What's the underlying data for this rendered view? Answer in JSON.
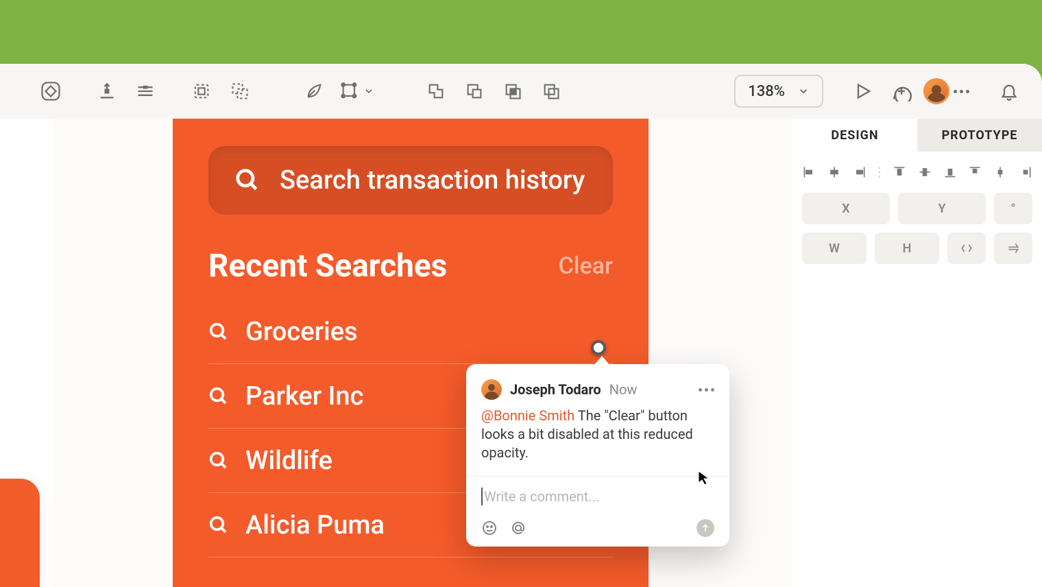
{
  "toolbar": {
    "zoom": "138%"
  },
  "inspector": {
    "tabs": {
      "design": "DESIGN",
      "prototype": "PROTOTYPE"
    },
    "fields": {
      "x": "X",
      "y": "Y",
      "deg": "°",
      "w": "W",
      "h": "H"
    }
  },
  "artboard": {
    "search_placeholder": "Search transaction history",
    "recent_title": "Recent Searches",
    "clear_label": "Clear",
    "items": [
      {
        "label": "Groceries"
      },
      {
        "label": "Parker Inc"
      },
      {
        "label": "Wildlife"
      },
      {
        "label": "Alicia Puma"
      }
    ]
  },
  "comment": {
    "author": "Joseph Todaro",
    "time": "Now",
    "mention": "@Bonnie Smith",
    "body": " The \"Clear\" button looks a bit disabled at this reduced opacity.",
    "reply_placeholder": "Write a comment..."
  }
}
